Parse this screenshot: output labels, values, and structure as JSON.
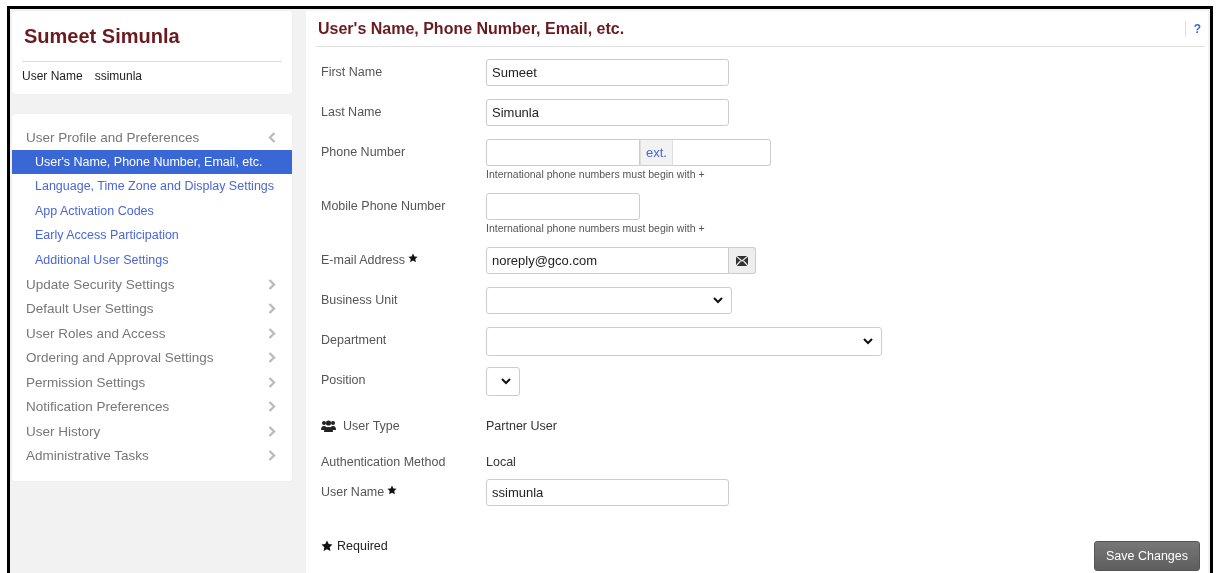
{
  "profile": {
    "name": "Sumeet Simunla",
    "username_label": "User Name",
    "username": "ssimunla"
  },
  "sidebar": {
    "sections": [
      {
        "label": "User Profile and Preferences",
        "expanded": true,
        "children": [
          {
            "label": "User's Name, Phone Number, Email, etc.",
            "selected": true
          },
          {
            "label": "Language, Time Zone and Display Settings",
            "selected": false
          },
          {
            "label": "App Activation Codes",
            "selected": false
          },
          {
            "label": "Early Access Participation",
            "selected": false
          },
          {
            "label": "Additional User Settings",
            "selected": false
          }
        ]
      },
      {
        "label": "Update Security Settings",
        "expanded": false
      },
      {
        "label": "Default User Settings",
        "expanded": false
      },
      {
        "label": "User Roles and Access",
        "expanded": false
      },
      {
        "label": "Ordering and Approval Settings",
        "expanded": false
      },
      {
        "label": "Permission Settings",
        "expanded": false
      },
      {
        "label": "Notification Preferences",
        "expanded": false
      },
      {
        "label": "User History",
        "expanded": false
      },
      {
        "label": "Administrative Tasks",
        "expanded": false
      }
    ]
  },
  "panel": {
    "title": "User's Name, Phone Number, Email, etc.",
    "help": "?",
    "fields": [
      {
        "kind": "text",
        "label": "First Name",
        "value": "Sumeet",
        "required": false
      },
      {
        "kind": "text",
        "label": "Last Name",
        "value": "Simunla",
        "required": false
      },
      {
        "kind": "phone",
        "label": "Phone Number",
        "ext": "ext.",
        "help": "International phone numbers must begin with +",
        "required": false
      },
      {
        "kind": "short-text",
        "label": "Mobile Phone Number",
        "help": "International phone numbers must begin with +",
        "required": false
      },
      {
        "kind": "email",
        "label": "E-mail Address",
        "value": "noreply@gco.com",
        "required": true
      },
      {
        "kind": "select",
        "label": "Business Unit",
        "required": false
      },
      {
        "kind": "wide-select",
        "label": "Department",
        "required": false
      },
      {
        "kind": "tiny-select",
        "label": "Position",
        "required": false
      },
      {
        "kind": "user-type",
        "label": "User Type",
        "value": "Partner User",
        "required": false
      },
      {
        "kind": "static",
        "label": "Authentication Method",
        "value": "Local",
        "required": false
      },
      {
        "kind": "text",
        "label": "User Name",
        "value": "ssimunla",
        "required": true
      }
    ],
    "required_note": "Required",
    "save_button": "Save Changes"
  }
}
